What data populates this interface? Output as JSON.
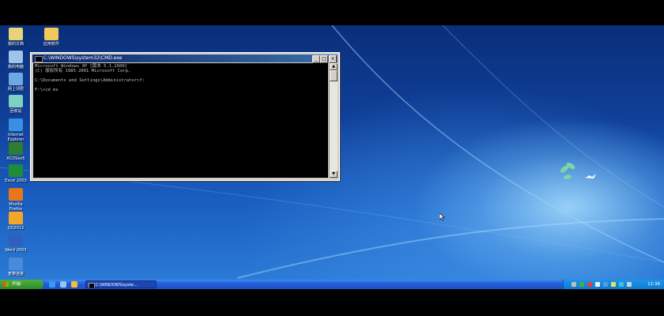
{
  "desktop_icons": [
    {
      "name": "my-documents",
      "label": "我的文档",
      "color": "#e8d27a",
      "icon": "folder-doc-icon"
    },
    {
      "name": "apps",
      "label": "应用软件",
      "color": "#f0c95a",
      "icon": "folder-icon"
    },
    {
      "name": "my-computer",
      "label": "我的电脑",
      "color": "#9fc4e8",
      "icon": "computer-icon"
    },
    {
      "name": "network",
      "label": "网上邻居",
      "color": "#6ea8e0",
      "icon": "network-icon"
    },
    {
      "name": "recycle-bin",
      "label": "回收站",
      "color": "#7fd0c0",
      "icon": "recycle-bin-icon"
    },
    {
      "name": "internet-explorer",
      "label": "Internet\nExplorer",
      "color": "#3a8fe0",
      "icon": "ie-icon"
    },
    {
      "name": "acdsee",
      "label": "ACDSee5",
      "color": "#2e7d32",
      "icon": "acdsee-icon"
    },
    {
      "name": "excel",
      "label": "Excel 2003",
      "color": "#1e8c3a",
      "icon": "excel-icon"
    },
    {
      "name": "firefox",
      "label": "Mozilla\nFirefox",
      "color": "#e8761a",
      "icon": "firefox-icon"
    },
    {
      "name": "qq",
      "label": "QQ2012",
      "color": "#f4a62a",
      "icon": "qq-icon"
    },
    {
      "name": "word",
      "label": "Word 2003",
      "color": "#2f5fbf",
      "icon": "word-icon"
    },
    {
      "name": "broadband",
      "label": "宽带连接",
      "color": "#4a8ad8",
      "icon": "broadband-icon"
    }
  ],
  "cmd_window": {
    "title": "C:\\WINDOWS\\system32\\CMD.exe",
    "min_label": "_",
    "max_label": "□",
    "close_label": "×",
    "lines": [
      "Microsoft Windows XP [版本 5.1.2600]",
      "(C) 版权所有 1985-2001 Microsoft Corp.",
      "",
      "C:\\Documents and Settings\\Administrator>f:",
      "",
      "F:\\>cd ms"
    ]
  },
  "taskbar": {
    "start_label": "开始",
    "task_label": "C:\\WINDOWS\\syste...",
    "clock": "11:38"
  },
  "colors": {
    "quick_launch": [
      "#3a9af0",
      "#8fc8f0",
      "#f4c03a"
    ],
    "tray": [
      "#c0c0c0",
      "#3fb04a",
      "#e04040",
      "#f0f0f0",
      "#4aa0e8",
      "#e8e060",
      "#40c0e0",
      "#d0d0d0"
    ]
  }
}
